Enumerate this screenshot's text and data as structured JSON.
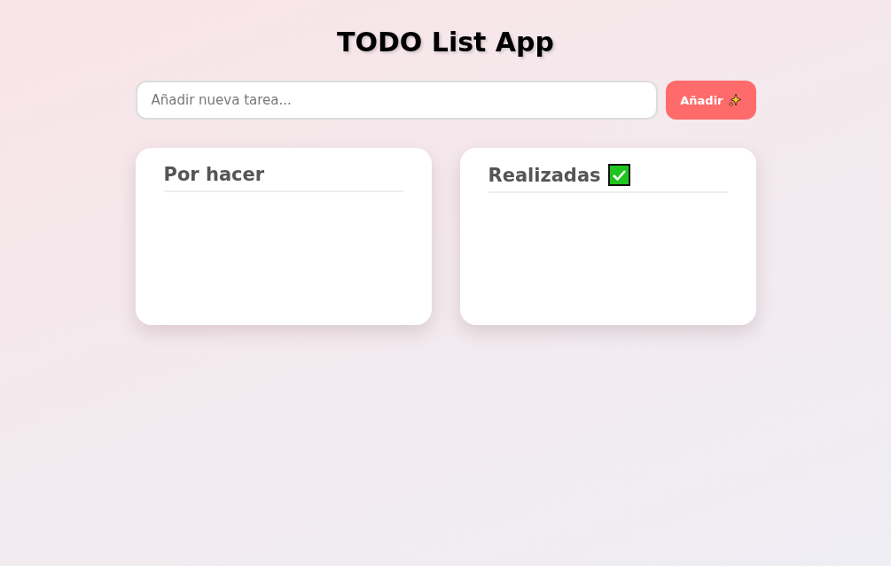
{
  "title": "TODO List App",
  "new_task": {
    "placeholder": "Añadir nueva tarea...",
    "button": "Añadir"
  },
  "columns": [
    {
      "title": "Por hacer",
      "kind": "todo"
    },
    {
      "title": "Realizadas",
      "kind": "done"
    }
  ]
}
